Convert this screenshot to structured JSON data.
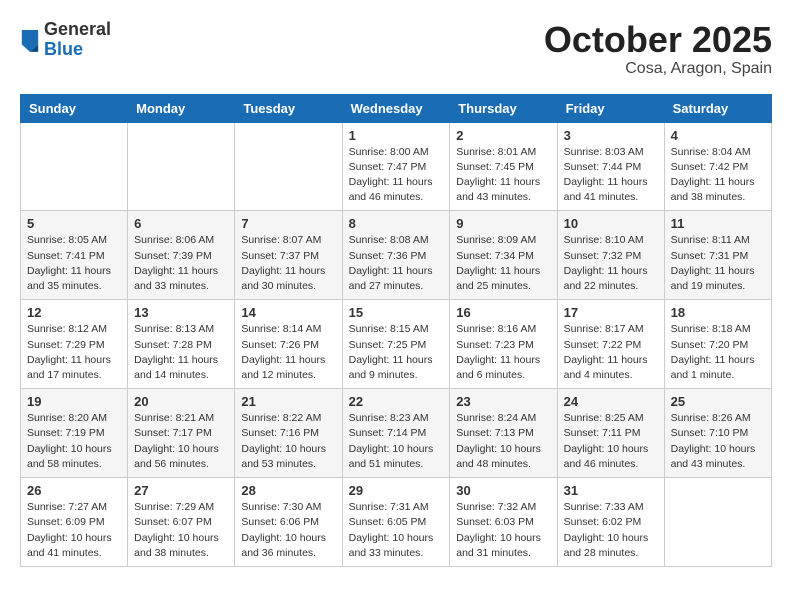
{
  "header": {
    "logo_general": "General",
    "logo_blue": "Blue",
    "title": "October 2025",
    "subtitle": "Cosa, Aragon, Spain"
  },
  "weekdays": [
    "Sunday",
    "Monday",
    "Tuesday",
    "Wednesday",
    "Thursday",
    "Friday",
    "Saturday"
  ],
  "weeks": [
    [
      {
        "day": "",
        "info": ""
      },
      {
        "day": "",
        "info": ""
      },
      {
        "day": "",
        "info": ""
      },
      {
        "day": "1",
        "info": "Sunrise: 8:00 AM\nSunset: 7:47 PM\nDaylight: 11 hours\nand 46 minutes."
      },
      {
        "day": "2",
        "info": "Sunrise: 8:01 AM\nSunset: 7:45 PM\nDaylight: 11 hours\nand 43 minutes."
      },
      {
        "day": "3",
        "info": "Sunrise: 8:03 AM\nSunset: 7:44 PM\nDaylight: 11 hours\nand 41 minutes."
      },
      {
        "day": "4",
        "info": "Sunrise: 8:04 AM\nSunset: 7:42 PM\nDaylight: 11 hours\nand 38 minutes."
      }
    ],
    [
      {
        "day": "5",
        "info": "Sunrise: 8:05 AM\nSunset: 7:41 PM\nDaylight: 11 hours\nand 35 minutes."
      },
      {
        "day": "6",
        "info": "Sunrise: 8:06 AM\nSunset: 7:39 PM\nDaylight: 11 hours\nand 33 minutes."
      },
      {
        "day": "7",
        "info": "Sunrise: 8:07 AM\nSunset: 7:37 PM\nDaylight: 11 hours\nand 30 minutes."
      },
      {
        "day": "8",
        "info": "Sunrise: 8:08 AM\nSunset: 7:36 PM\nDaylight: 11 hours\nand 27 minutes."
      },
      {
        "day": "9",
        "info": "Sunrise: 8:09 AM\nSunset: 7:34 PM\nDaylight: 11 hours\nand 25 minutes."
      },
      {
        "day": "10",
        "info": "Sunrise: 8:10 AM\nSunset: 7:32 PM\nDaylight: 11 hours\nand 22 minutes."
      },
      {
        "day": "11",
        "info": "Sunrise: 8:11 AM\nSunset: 7:31 PM\nDaylight: 11 hours\nand 19 minutes."
      }
    ],
    [
      {
        "day": "12",
        "info": "Sunrise: 8:12 AM\nSunset: 7:29 PM\nDaylight: 11 hours\nand 17 minutes."
      },
      {
        "day": "13",
        "info": "Sunrise: 8:13 AM\nSunset: 7:28 PM\nDaylight: 11 hours\nand 14 minutes."
      },
      {
        "day": "14",
        "info": "Sunrise: 8:14 AM\nSunset: 7:26 PM\nDaylight: 11 hours\nand 12 minutes."
      },
      {
        "day": "15",
        "info": "Sunrise: 8:15 AM\nSunset: 7:25 PM\nDaylight: 11 hours\nand 9 minutes."
      },
      {
        "day": "16",
        "info": "Sunrise: 8:16 AM\nSunset: 7:23 PM\nDaylight: 11 hours\nand 6 minutes."
      },
      {
        "day": "17",
        "info": "Sunrise: 8:17 AM\nSunset: 7:22 PM\nDaylight: 11 hours\nand 4 minutes."
      },
      {
        "day": "18",
        "info": "Sunrise: 8:18 AM\nSunset: 7:20 PM\nDaylight: 11 hours\nand 1 minute."
      }
    ],
    [
      {
        "day": "19",
        "info": "Sunrise: 8:20 AM\nSunset: 7:19 PM\nDaylight: 10 hours\nand 58 minutes."
      },
      {
        "day": "20",
        "info": "Sunrise: 8:21 AM\nSunset: 7:17 PM\nDaylight: 10 hours\nand 56 minutes."
      },
      {
        "day": "21",
        "info": "Sunrise: 8:22 AM\nSunset: 7:16 PM\nDaylight: 10 hours\nand 53 minutes."
      },
      {
        "day": "22",
        "info": "Sunrise: 8:23 AM\nSunset: 7:14 PM\nDaylight: 10 hours\nand 51 minutes."
      },
      {
        "day": "23",
        "info": "Sunrise: 8:24 AM\nSunset: 7:13 PM\nDaylight: 10 hours\nand 48 minutes."
      },
      {
        "day": "24",
        "info": "Sunrise: 8:25 AM\nSunset: 7:11 PM\nDaylight: 10 hours\nand 46 minutes."
      },
      {
        "day": "25",
        "info": "Sunrise: 8:26 AM\nSunset: 7:10 PM\nDaylight: 10 hours\nand 43 minutes."
      }
    ],
    [
      {
        "day": "26",
        "info": "Sunrise: 7:27 AM\nSunset: 6:09 PM\nDaylight: 10 hours\nand 41 minutes."
      },
      {
        "day": "27",
        "info": "Sunrise: 7:29 AM\nSunset: 6:07 PM\nDaylight: 10 hours\nand 38 minutes."
      },
      {
        "day": "28",
        "info": "Sunrise: 7:30 AM\nSunset: 6:06 PM\nDaylight: 10 hours\nand 36 minutes."
      },
      {
        "day": "29",
        "info": "Sunrise: 7:31 AM\nSunset: 6:05 PM\nDaylight: 10 hours\nand 33 minutes."
      },
      {
        "day": "30",
        "info": "Sunrise: 7:32 AM\nSunset: 6:03 PM\nDaylight: 10 hours\nand 31 minutes."
      },
      {
        "day": "31",
        "info": "Sunrise: 7:33 AM\nSunset: 6:02 PM\nDaylight: 10 hours\nand 28 minutes."
      },
      {
        "day": "",
        "info": ""
      }
    ]
  ]
}
